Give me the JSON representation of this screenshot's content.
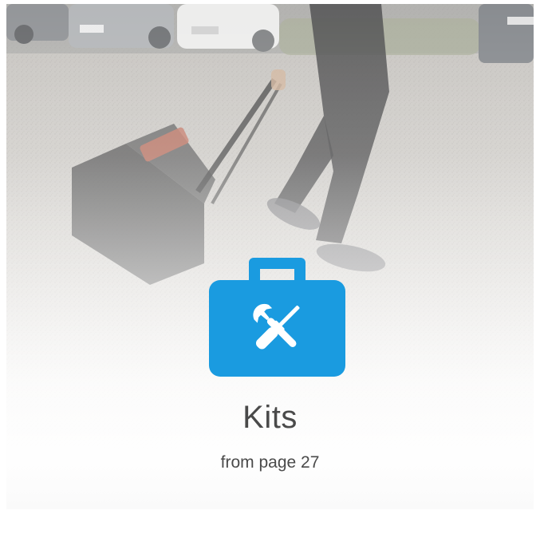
{
  "card": {
    "title": "Kits",
    "subtitle": "from page 27",
    "icon": "toolbox-wrench-screwdriver-icon",
    "accent_color": "#1a9be0"
  }
}
